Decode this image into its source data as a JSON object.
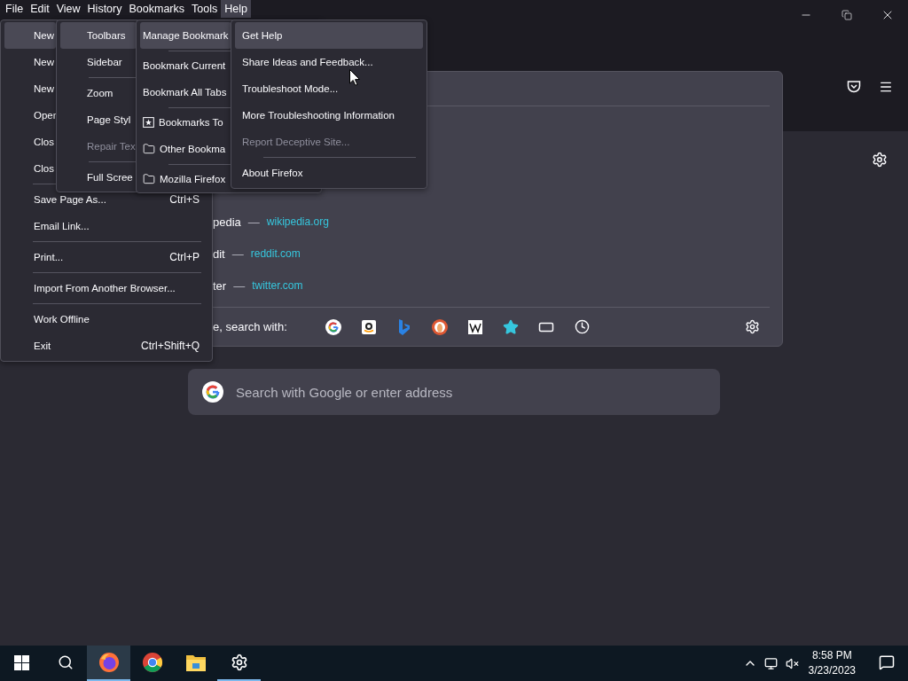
{
  "menubar": [
    {
      "label": "File",
      "selected": false
    },
    {
      "label": "Edit",
      "selected": false
    },
    {
      "label": "View",
      "selected": false
    },
    {
      "label": "History",
      "selected": false
    },
    {
      "label": "Bookmarks",
      "selected": false
    },
    {
      "label": "Tools",
      "selected": false
    },
    {
      "label": "Help",
      "selected": true
    }
  ],
  "address_panel": {
    "results": [
      {
        "title": "pedia",
        "separator": "—",
        "url": "wikipedia.org"
      },
      {
        "title": "dit",
        "separator": "—",
        "url": "reddit.com"
      },
      {
        "title": "ter",
        "separator": "—",
        "url": "twitter.com"
      }
    ],
    "search_with_label": "e, search with:",
    "engines": [
      {
        "kind": "google"
      },
      {
        "kind": "amazon"
      },
      {
        "kind": "bing"
      },
      {
        "kind": "duckduckgo"
      },
      {
        "kind": "wikipedia"
      },
      {
        "kind": "bookmarks"
      },
      {
        "kind": "tabs"
      },
      {
        "kind": "history"
      }
    ]
  },
  "new_tab": {
    "search_placeholder": "Search with Google or enter address"
  },
  "menus": [
    {
      "items": [
        {
          "kind": "item",
          "label": "New",
          "selected": true,
          "disabled": false
        },
        {
          "kind": "item",
          "label": "New",
          "selected": false,
          "disabled": false
        },
        {
          "kind": "item",
          "label": "New",
          "selected": false,
          "disabled": false
        },
        {
          "kind": "item",
          "label": "Oper",
          "selected": false,
          "disabled": false
        },
        {
          "kind": "item",
          "label": "Clos",
          "selected": false,
          "disabled": false
        },
        {
          "kind": "item",
          "label": "Clos",
          "selected": false,
          "disabled": false
        },
        {
          "kind": "separator"
        },
        {
          "kind": "item",
          "label": "Save Page As...",
          "shortcut": "Ctrl+S",
          "selected": false,
          "disabled": false
        },
        {
          "kind": "item",
          "label": "Email Link...",
          "selected": false,
          "disabled": false
        },
        {
          "kind": "separator"
        },
        {
          "kind": "item",
          "label": "Print...",
          "shortcut": "Ctrl+P",
          "selected": false,
          "disabled": false
        },
        {
          "kind": "separator"
        },
        {
          "kind": "item",
          "label": "Import From Another Browser...",
          "selected": false,
          "disabled": false
        },
        {
          "kind": "separator"
        },
        {
          "kind": "item",
          "label": "Work Offline",
          "selected": false,
          "disabled": false
        },
        {
          "kind": "item",
          "label": "Exit",
          "shortcut": "Ctrl+Shift+Q",
          "selected": false,
          "disabled": false
        }
      ]
    },
    {
      "items": [
        {
          "kind": "item",
          "label": "Toolbars",
          "selected": true,
          "disabled": false
        },
        {
          "kind": "item",
          "label": "Sidebar",
          "selected": false,
          "disabled": false
        },
        {
          "kind": "separator"
        },
        {
          "kind": "item",
          "label": "Zoom",
          "selected": false,
          "disabled": false
        },
        {
          "kind": "item",
          "label": "Page Styl",
          "selected": false,
          "disabled": false
        },
        {
          "kind": "item",
          "label": "Repair Tex",
          "selected": false,
          "disabled": true
        },
        {
          "kind": "separator"
        },
        {
          "kind": "item",
          "label": "Full Scree",
          "selected": false,
          "disabled": false
        }
      ]
    },
    {
      "items": [
        {
          "kind": "item",
          "label": "Manage Bookmark",
          "selected": true,
          "disabled": false
        },
        {
          "kind": "separator"
        },
        {
          "kind": "item",
          "label": "Bookmark Current",
          "selected": false,
          "disabled": false
        },
        {
          "kind": "item",
          "label": "Bookmark All Tabs",
          "selected": false,
          "disabled": false
        },
        {
          "kind": "separator"
        },
        {
          "kind": "starred_folder",
          "label": "Bookmarks To",
          "selected": false,
          "disabled": false
        },
        {
          "kind": "folder",
          "label": "Other Bookma",
          "selected": false,
          "disabled": false
        },
        {
          "kind": "separator"
        },
        {
          "kind": "folder",
          "label": "Mozilla Firefox",
          "selected": false,
          "disabled": false
        }
      ]
    },
    {
      "items": [
        {
          "kind": "item",
          "label": "Get Help",
          "selected": true,
          "disabled": false
        },
        {
          "kind": "item",
          "label": "Share Ideas and Feedback...",
          "selected": false,
          "disabled": false
        },
        {
          "kind": "item",
          "label": "Troubleshoot Mode...",
          "selected": false,
          "disabled": false
        },
        {
          "kind": "item",
          "label": "More Troubleshooting Information",
          "selected": false,
          "disabled": false
        },
        {
          "kind": "item",
          "label": "Report Deceptive Site...",
          "selected": false,
          "disabled": true
        },
        {
          "kind": "separator"
        },
        {
          "kind": "item",
          "label": "About Firefox",
          "selected": false,
          "disabled": false
        }
      ]
    }
  ],
  "taskbar": {
    "apps": [
      {
        "kind": "firefox",
        "selected": true,
        "open": true
      },
      {
        "kind": "chrome",
        "selected": false,
        "open": false
      },
      {
        "kind": "files",
        "selected": false,
        "open": false
      },
      {
        "kind": "settings",
        "selected": false,
        "open": true
      }
    ],
    "time": "8:58 PM",
    "date": "3/23/2023"
  }
}
